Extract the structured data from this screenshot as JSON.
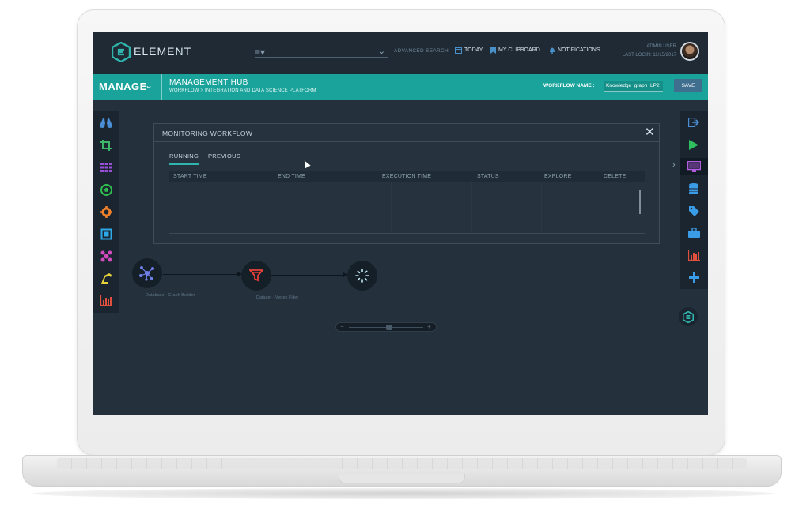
{
  "app": {
    "logo_text": "ELEMENT",
    "nav": {
      "advanced_search": "ADVANCED SEARCH",
      "today": "TODAY",
      "clipboard": "MY CLIPBOARD",
      "notifications": "NOTIFICATIONS"
    },
    "user": {
      "name": "ADMIN USER",
      "last_login": "LAST LOGIN: 11/15/2017"
    }
  },
  "header": {
    "section": "MANAGE",
    "title": "MANAGEMENT HUB",
    "breadcrumb": "WORKFLOW > INTEGRATION AND DATA SCIENCE PLATFORM",
    "workflow_name_label": "WORKFLOW NAME :",
    "workflow_name_value": "Knowledge_graph_LP2",
    "save_label": "SAVE"
  },
  "left_toolbar": {
    "icons": [
      "binoculars-icon",
      "crop-icon",
      "grid-icon",
      "soccer-ball-icon",
      "gear-icon",
      "frame-icon",
      "molecule-icon",
      "robot-arm-icon",
      "bar-chart-icon"
    ]
  },
  "right_toolbar": {
    "icons": [
      "export-icon",
      "play-icon",
      "monitor-icon",
      "database-icon",
      "tag-icon",
      "briefcase-icon",
      "bar-chart-icon",
      "plus-icon"
    ],
    "active": "monitor-icon"
  },
  "modal": {
    "title": "MONITORING WORKFLOW",
    "tabs": [
      {
        "label": "RUNNING",
        "active": true
      },
      {
        "label": "PREVIOUS",
        "active": false
      }
    ],
    "columns": [
      "START TIME",
      "END TIME",
      "EXECUTION TIME",
      "STATUS",
      "EXPLORE",
      "DELETE"
    ]
  },
  "workflow": {
    "nodes": [
      {
        "label": "Database · Graph Builder"
      },
      {
        "label": "Dataset · Vertex Filter"
      },
      {
        "label": ""
      }
    ]
  },
  "colors": {
    "accent": "#1aa39b",
    "topbar": "#1f2a35",
    "canvas": "#24313d",
    "save_button": "#3f6e8f"
  }
}
